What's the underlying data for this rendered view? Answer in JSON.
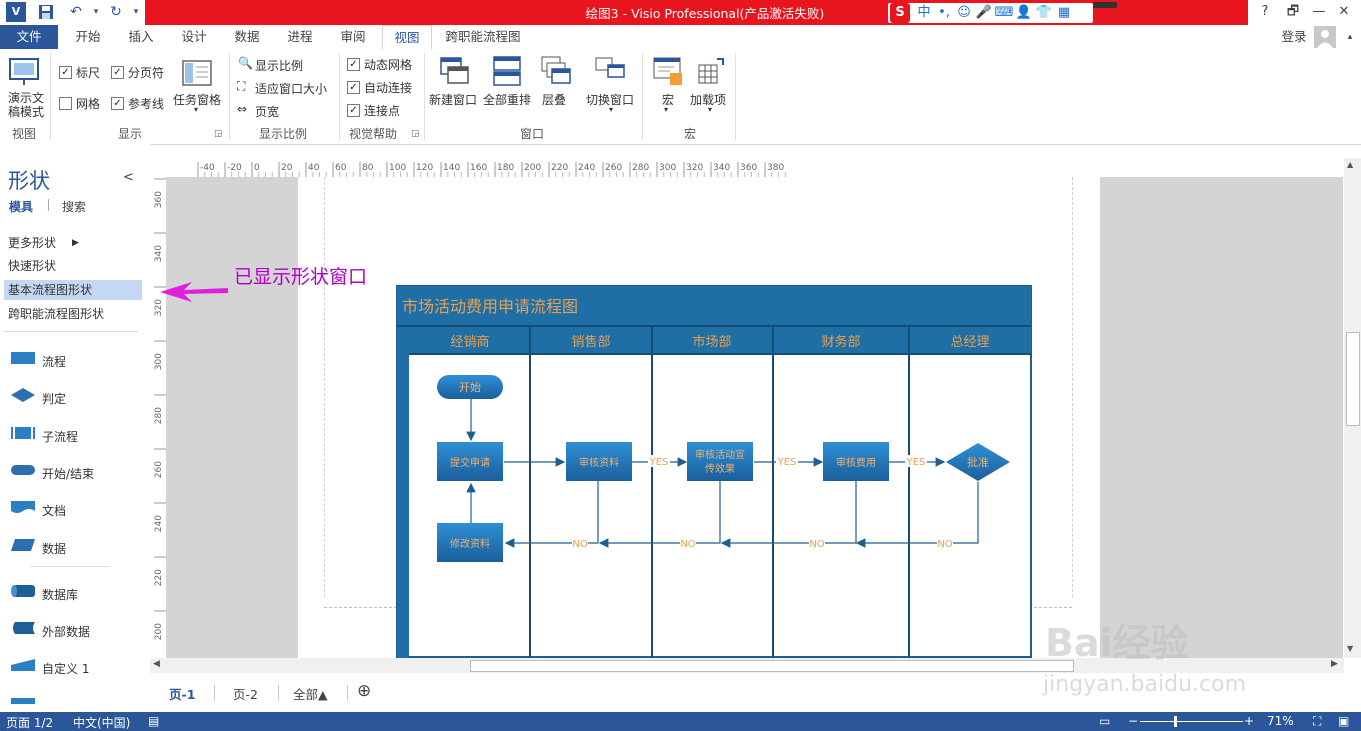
{
  "app": {
    "title": "绘图3 - Visio Professional(产品激活失败)",
    "accent_color": "#2b579a",
    "title_bar_color": "#e8141e",
    "login_label": "登录"
  },
  "quick_access": [
    "visio-logo-icon",
    "save-icon",
    "undo-icon",
    "redo-icon"
  ],
  "ime": {
    "logo": "S",
    "mode": "中"
  },
  "window_buttons": [
    "?",
    "🗗",
    "—",
    "🗗",
    "✕"
  ],
  "tabs": [
    {
      "label": "文件"
    },
    {
      "label": "开始"
    },
    {
      "label": "插入"
    },
    {
      "label": "设计"
    },
    {
      "label": "数据"
    },
    {
      "label": "进程"
    },
    {
      "label": "审阅"
    },
    {
      "label": "视图"
    },
    {
      "label": "跨职能流程图"
    }
  ],
  "ribbon": {
    "view_group": {
      "label": "视图",
      "presentation_mode": "演示文稿模式"
    },
    "show_group": {
      "label": "显示",
      "ruler": "标尺",
      "page_breaks": "分页符",
      "grid": "网格",
      "guides": "参考线",
      "task_pane": "任务窗格"
    },
    "zoom_group": {
      "label": "显示比例",
      "zoom": "显示比例",
      "fit_window": "适应窗口大小",
      "page_width": "页宽"
    },
    "visual_aids_group": {
      "label": "视觉帮助",
      "dynamic_grid": "动态网格",
      "auto_connect": "自动连接",
      "connection_points": "连接点"
    },
    "window_group": {
      "label": "窗口",
      "new_window": "新建窗口",
      "arrange_all": "全部重排",
      "cascade": "层叠",
      "switch_windows": "切换窗口"
    },
    "macros_group": {
      "label": "宏",
      "macros": "宏",
      "addins": "加载项"
    }
  },
  "shapes_pane": {
    "title": "形状",
    "collapse": "<",
    "nav_stencils": "模具",
    "nav_search": "搜索",
    "more_shapes": "更多形状",
    "stencils": [
      "快速形状",
      "基本流程图形状",
      "跨职能流程图形状"
    ],
    "masters": [
      "流程",
      "判定",
      "子流程",
      "开始/结束",
      "文档",
      "数据",
      "数据库",
      "外部数据",
      "自定义 1"
    ]
  },
  "rulers": {
    "h_ticks": [
      "-40",
      "-20",
      "0",
      "20",
      "40",
      "60",
      "80",
      "100",
      "120",
      "140",
      "160",
      "180",
      "200",
      "220",
      "240",
      "260",
      "280",
      "300",
      "320",
      "340",
      "360",
      "380"
    ],
    "v_ticks": [
      "360",
      "340",
      "320",
      "300",
      "280",
      "260",
      "240",
      "220",
      "200"
    ]
  },
  "annotation": "已显示形状窗口",
  "diagram": {
    "title": "市场活动费用申请流程图",
    "lanes": [
      "经销商",
      "销售部",
      "市场部",
      "财务部",
      "总经理"
    ],
    "nodes": {
      "start": "开始",
      "submit": "提交申请",
      "review_docs": "审核资料",
      "review_activity_1": "审核活动宣",
      "review_activity_2": "传效果",
      "review_cost": "审核费用",
      "approve": "批准",
      "modify": "修改资料"
    },
    "yes": "YES",
    "no": "NO"
  },
  "page_tabs": {
    "p1": "页-1",
    "p2": "页-2",
    "all": "全部▲",
    "add": "⊕"
  },
  "status": {
    "page": "页面 1/2",
    "lang": "中文(中国)",
    "zoom": "71%"
  },
  "watermark": {
    "logo": "Bai经验",
    "url": "jingyan.baidu.com"
  }
}
